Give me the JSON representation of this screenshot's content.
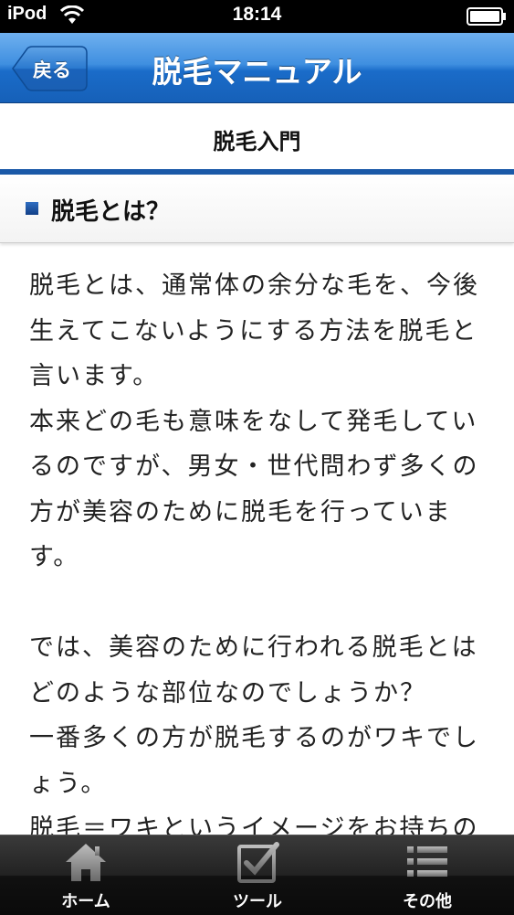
{
  "status_bar": {
    "carrier": "iPod",
    "time": "18:14"
  },
  "nav": {
    "back_label": "戻る",
    "title": "脱毛マニュアル"
  },
  "section": {
    "title": "脱毛入門"
  },
  "subsection": {
    "title": "脱毛とは？"
  },
  "body_paragraphs": [
    "脱毛とは、通常体の余分な毛を、今後生えてこないようにする方法を脱毛と言います。",
    "本来どの毛も意味をなして発毛しているのですが、男女・世代問わず多くの方が美容のために脱毛を行っています。",
    "",
    "では、美容のために行われる脱毛とはどのような部位なのでしょうか？",
    "一番多くの方が脱毛するのがワキでしょう。",
    "脱毛＝ワキというイメージをお持ちの"
  ],
  "tabs": [
    {
      "label": "ホーム",
      "icon": "home-icon"
    },
    {
      "label": "ツール",
      "icon": "checkbox-icon"
    },
    {
      "label": "その他",
      "icon": "list-icon"
    }
  ]
}
